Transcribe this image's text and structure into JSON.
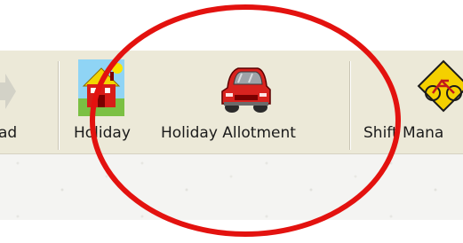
{
  "toolbar": {
    "buttons": [
      {
        "label": "ad",
        "icon": "download-icon-partial"
      },
      {
        "label": "Holiday",
        "icon": "house-icon"
      },
      {
        "label": "Holiday Allotment",
        "icon": "car-icon"
      },
      {
        "label": "Shift Mana",
        "icon": "bicycle-sign-icon"
      }
    ]
  },
  "colors": {
    "toolbar_bg": "#ece9d8",
    "annotation_circle": "#e3120f",
    "car_red": "#d8231f",
    "house_red": "#d81d18",
    "sign_yellow": "#f4d000"
  }
}
